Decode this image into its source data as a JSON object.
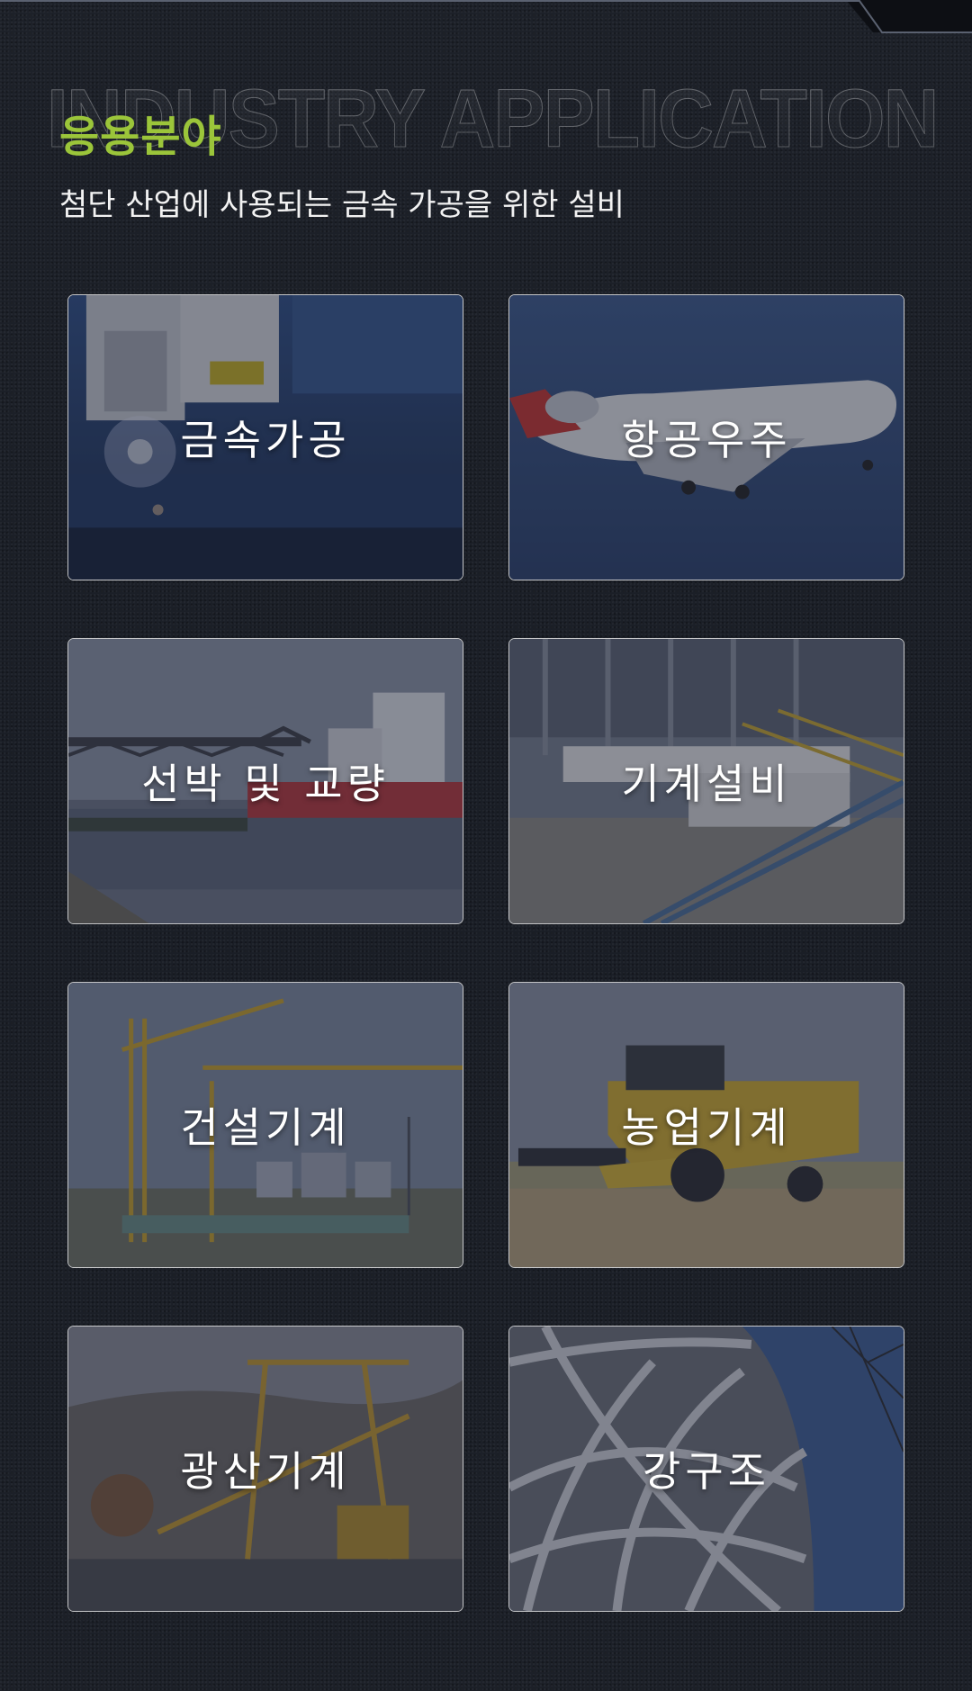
{
  "header": {
    "bg_word": "INDUSTRY APPLICATION",
    "title": "응용분야",
    "subtitle": "첨단 산업에 사용되는 금속 가공을 위한 설비"
  },
  "colors": {
    "accent": "#9bc53a",
    "background": "#1b1f27",
    "card_border": "#ffffff"
  },
  "cards": [
    {
      "label": "금속가공",
      "icon": "metal-processing-image"
    },
    {
      "label": "항공우주",
      "icon": "aerospace-image"
    },
    {
      "label": "선박 및 교량",
      "icon": "ships-bridges-image"
    },
    {
      "label": "기계설비",
      "icon": "machinery-image"
    },
    {
      "label": "건설기계",
      "icon": "construction-machinery-image"
    },
    {
      "label": "농업기계",
      "icon": "agricultural-machinery-image"
    },
    {
      "label": "광산기계",
      "icon": "mining-machinery-image"
    },
    {
      "label": "강구조",
      "icon": "steel-structure-image"
    }
  ]
}
